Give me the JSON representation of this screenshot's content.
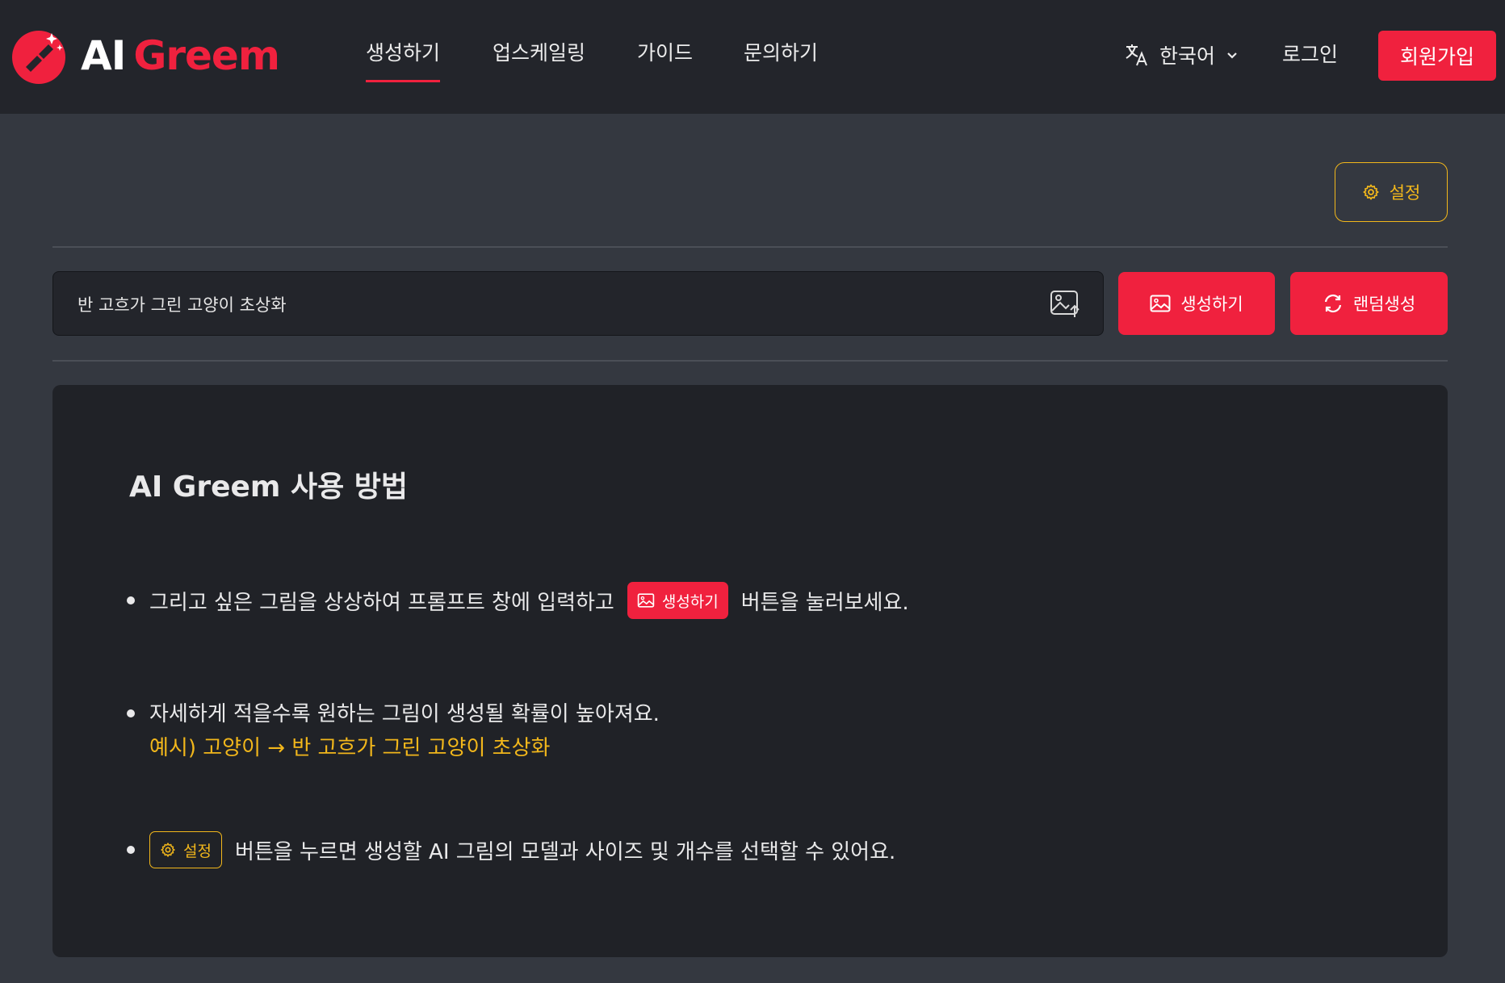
{
  "header": {
    "logo": {
      "ai": "AI",
      "greem": "Greem"
    },
    "nav": [
      "생성하기",
      "업스케일링",
      "가이드",
      "문의하기"
    ],
    "active_nav": "생성하기",
    "language": {
      "label": "한국어",
      "icon": "translate-icon"
    },
    "login": "로그인",
    "signup": "회원가입"
  },
  "toolbar": {
    "settings_label": "설정",
    "settings_icon": "gear-icon"
  },
  "prompt": {
    "value": "반 고흐가 그린 고양이 초상화",
    "upload_icon": "image-upload-icon",
    "generate_label": "생성하기",
    "random_label": "랜덤생성"
  },
  "guide": {
    "title": "AI Greem 사용 방법",
    "item1": {
      "before": "그리고 싶은 그림을 상상하여 프롬프트 창에 입력하고",
      "chip": "생성하기",
      "after": "버튼을 눌러보세요."
    },
    "item2": {
      "text": "자세하게 적을수록 원하는 그림이 생성될 확률이 높아져요.",
      "example": "예시) 고양이 → 반 고흐가 그린 고양이 초상화"
    },
    "item3": {
      "chip": "설정",
      "after": "버튼을 누르면 생성할 AI 그림의 모델과 사이즈 및 개수를 선택할 수 있어요."
    }
  },
  "colors": {
    "accent": "#f0213e",
    "highlight": "#f2b71b",
    "header_bg": "#23252b",
    "page_bg": "#343840",
    "card_bg": "#202227"
  }
}
